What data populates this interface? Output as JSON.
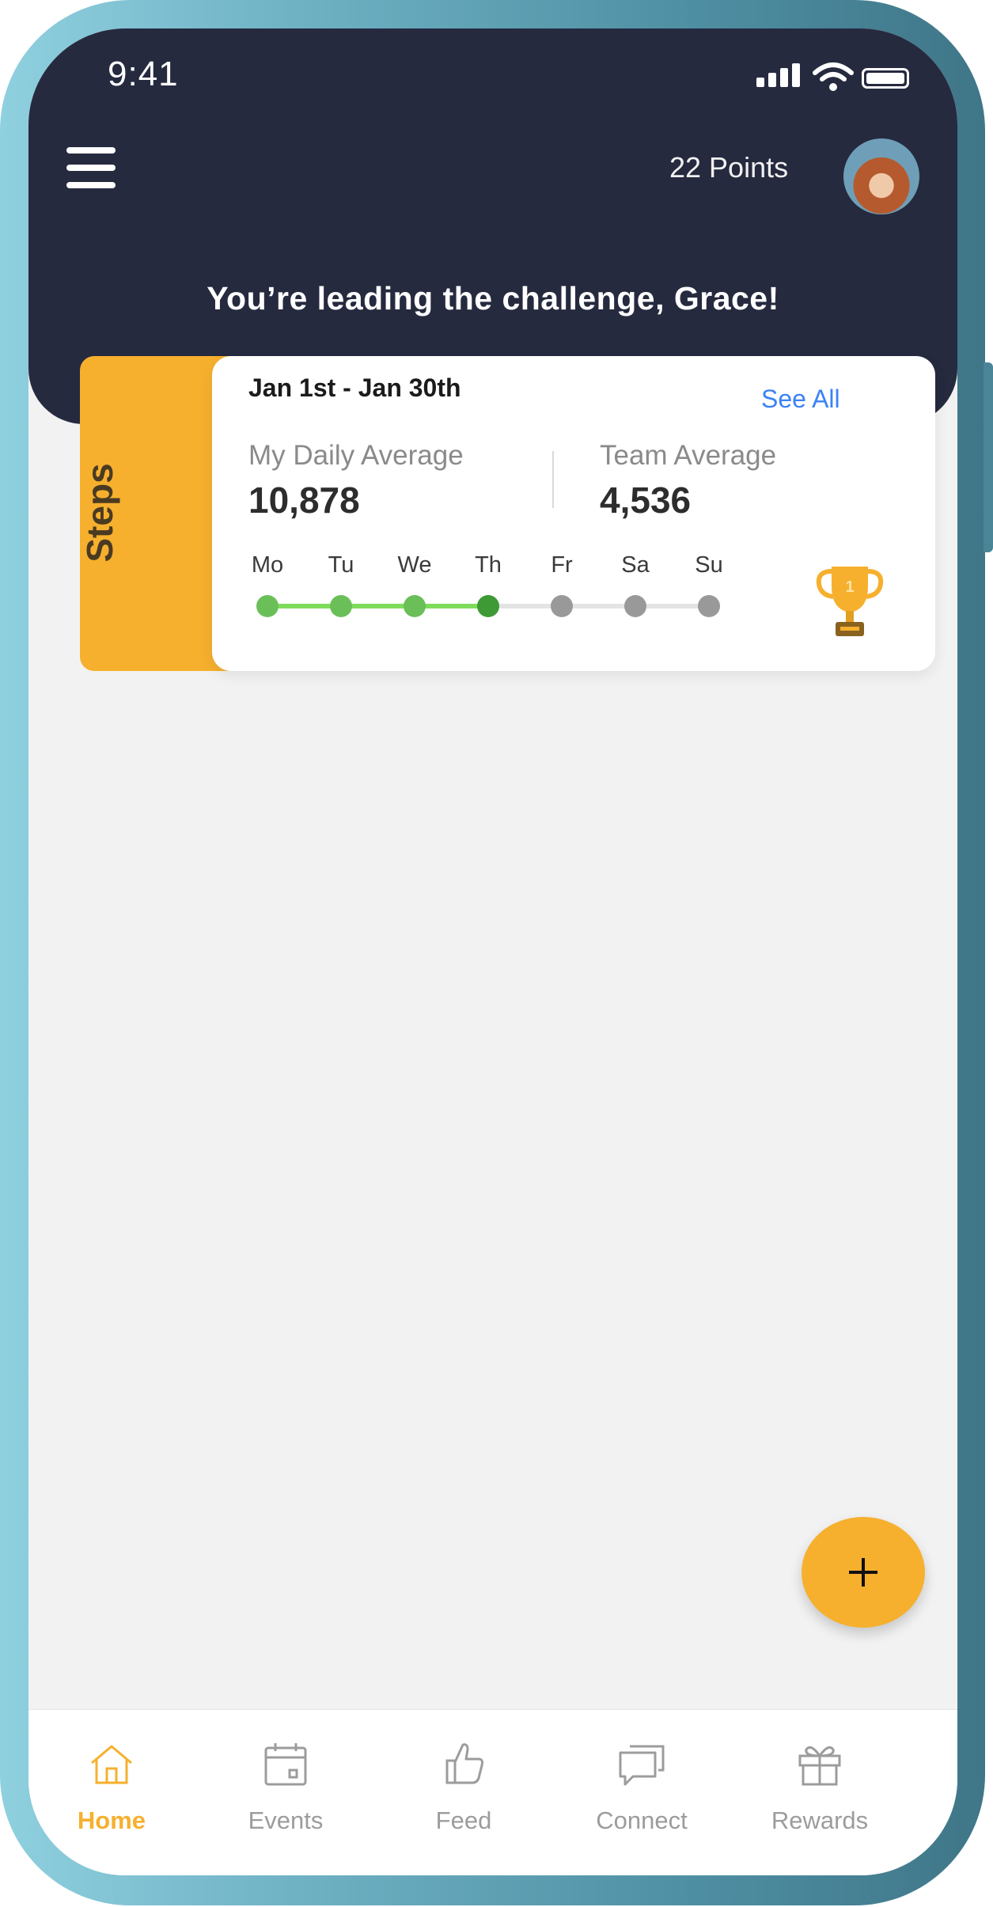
{
  "status_bar": {
    "time": "9:41"
  },
  "header": {
    "points": "22 Points",
    "headline": "You’re leading the challenge, Grace!"
  },
  "challenge_card": {
    "category": "Steps",
    "date_range": "Jan 1st - Jan 30th",
    "see_all": "See All",
    "my_average": {
      "label": "My Daily Average",
      "value": "10,878"
    },
    "team_average": {
      "label": "Team Average",
      "value": "4,536"
    },
    "days": [
      {
        "label": "Mo",
        "completed": true
      },
      {
        "label": "Tu",
        "completed": true
      },
      {
        "label": "We",
        "completed": true
      },
      {
        "label": "Th",
        "completed": true,
        "current": true
      },
      {
        "label": "Fr",
        "completed": false
      },
      {
        "label": "Sa",
        "completed": false
      },
      {
        "label": "Su",
        "completed": false
      }
    ],
    "trophy_rank": "1"
  },
  "fab": {
    "icon": "plus-icon"
  },
  "bottom_nav": [
    {
      "label": "Home",
      "icon": "home-icon",
      "active": true
    },
    {
      "label": "Events",
      "icon": "calendar-icon",
      "active": false
    },
    {
      "label": "Feed",
      "icon": "thumbs-up-icon",
      "active": false
    },
    {
      "label": "Connect",
      "icon": "chat-icon",
      "active": false
    },
    {
      "label": "Rewards",
      "icon": "gift-icon",
      "active": false
    }
  ],
  "colors": {
    "header_bg": "#262a3f",
    "accent": "#f6b02e",
    "link": "#3b82f6",
    "progress_done": "#6bbf59",
    "progress_current": "#3d9a35",
    "progress_pending": "#999999"
  }
}
